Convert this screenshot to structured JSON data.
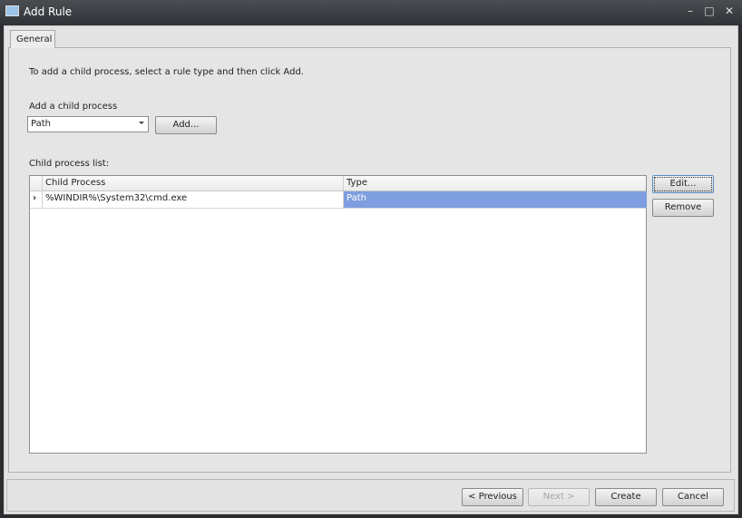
{
  "window": {
    "title": "Add Rule",
    "icon": "monitor-icon"
  },
  "tabs": [
    {
      "label": "General",
      "active": true
    }
  ],
  "general": {
    "instruction": "To add a child process, select a rule type and then click Add.",
    "add_label": "Add a child process",
    "rule_type_value": "Path",
    "add_button": "Add...",
    "list_label": "Child process list:",
    "columns": [
      "Child Process",
      "Type"
    ],
    "rows": [
      {
        "child_process": "%WINDIR%\\System32\\cmd.exe",
        "type": "Path",
        "selected": true
      }
    ],
    "edit_button": "Edit...",
    "remove_button": "Remove"
  },
  "footer": {
    "previous": "< Previous",
    "next": "Next >",
    "create": "Create",
    "cancel": "Cancel"
  },
  "colors": {
    "selection": "#7f9ee0"
  }
}
